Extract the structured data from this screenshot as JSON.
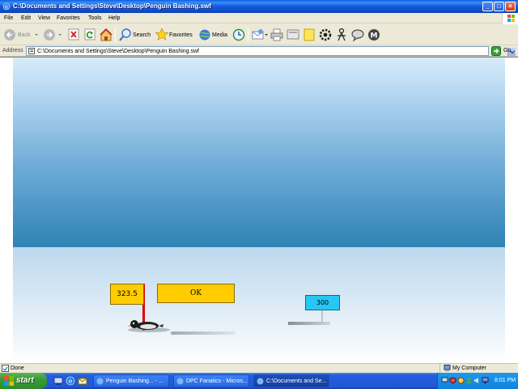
{
  "window": {
    "title": "C:\\Documents and Settings\\Steve\\Desktop\\Penguin Bashing.swf",
    "controls": {
      "minimize": "_",
      "maximize": "□",
      "close": "×"
    }
  },
  "menu": [
    "File",
    "Edit",
    "View",
    "Favorites",
    "Tools",
    "Help"
  ],
  "toolbar": {
    "back_label": "Back",
    "search_label": "Search",
    "favorites_label": "Favorites",
    "media_label": "Media",
    "icons": [
      "back-arrow-icon",
      "forward-arrow-icon",
      "stop-icon",
      "refresh-icon",
      "home-icon",
      "search-icon",
      "favorites-star-icon",
      "media-icon",
      "history-icon",
      "mail-icon",
      "print-icon",
      "edit-icon",
      "notes-icon",
      "settings-gear-icon",
      "messenger-icon",
      "discuss-icon",
      "research-icon"
    ]
  },
  "address": {
    "label": "Address",
    "url": "C:\\Documents and Settings\\Steve\\Desktop\\Penguin Bashing.swf",
    "go_label": "Go"
  },
  "game": {
    "distance": "323.5",
    "ok_label": "OK",
    "record": "300",
    "colors": {
      "sign": "#ffcc00",
      "record_sign": "#27c6f4",
      "pole": "#e00000"
    }
  },
  "status": {
    "text": "Done",
    "zone": "My Computer"
  },
  "taskbar": {
    "start_label": "start",
    "tasks": [
      {
        "label": "Penguin Bashing... - ..."
      },
      {
        "label": "DPC Fanatics - Micros..."
      },
      {
        "label": "C:\\Documents and Se..."
      }
    ],
    "clock": "8:01 PM"
  }
}
